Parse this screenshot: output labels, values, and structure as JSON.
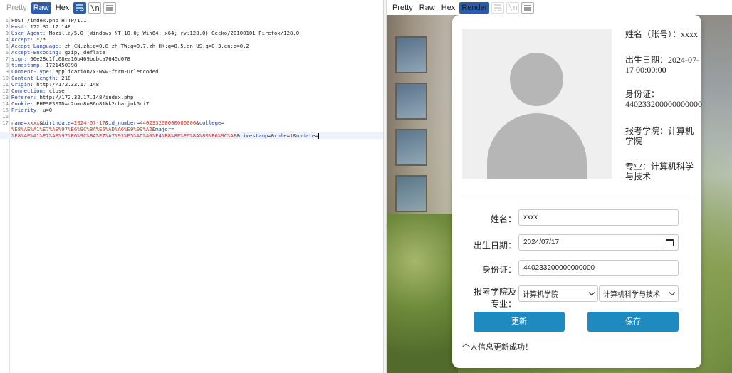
{
  "request_toolbar": {
    "pretty": "Pretty",
    "raw": "Raw",
    "hex": "Hex",
    "newline_toggle": "\\n"
  },
  "request": {
    "lines": [
      {
        "n": "1",
        "name": "",
        "rest": "POST /index.php HTTP/1.1"
      },
      {
        "n": "2",
        "name": "Host:",
        "rest": " 172.32.17.148"
      },
      {
        "n": "3",
        "name": "User-Agent:",
        "rest": " Mozilla/5.0 (Windows NT 10.0; Win64; x64; rv:128.0) Gecko/20100101 Firefox/128.0"
      },
      {
        "n": "4",
        "name": "Accept:",
        "rest": " */*"
      },
      {
        "n": "5",
        "name": "Accept-Language:",
        "rest": " zh-CN,zh;q=0.8,zh-TW;q=0.7,zh-HK;q=0.5,en-US;q=0.3,en;q=0.2"
      },
      {
        "n": "6",
        "name": "Accept-Encoding:",
        "rest": " gzip, deflate"
      },
      {
        "n": "7",
        "name": "sign:",
        "rest": " 66e28c1fc68ea10b469bcbca7645d078"
      },
      {
        "n": "8",
        "name": "timestamp:",
        "rest": " 1721450398"
      },
      {
        "n": "9",
        "name": "Content-Type:",
        "rest": " application/x-www-form-urlencoded"
      },
      {
        "n": "10",
        "name": "Content-Length:",
        "rest": " 218"
      },
      {
        "n": "11",
        "name": "Origin:",
        "rest": " http://172.32.17.148"
      },
      {
        "n": "12",
        "name": "Connection:",
        "rest": " close"
      },
      {
        "n": "13",
        "name": "Referer:",
        "rest": " http://172.32.17.148/index.php"
      },
      {
        "n": "14",
        "name": "Cookie:",
        "rest": " PHPSESSID=q2umn8n86u81kk2cbarjnk5ui7"
      },
      {
        "n": "15",
        "name": "Priority:",
        "rest": " u=0"
      },
      {
        "n": "16",
        "name": "",
        "rest": ""
      },
      {
        "n": "17",
        "name": "",
        "rest": ""
      }
    ],
    "body": {
      "l1a_key": "name",
      "l1a_val": "xxxx",
      "l1b_key": "birthdate",
      "l1b_val": "2024-07-17",
      "l1c_key": "id_number",
      "l1c_val": "440233200000000000",
      "l1d_key": "college",
      "l2_val": "%E8%AE%A1%E7%AE%97%E6%9C%BA%E5%AD%A6%E9%99%A2",
      "l2_key": "major",
      "l3_val": "%E8%AE%A1%E7%AE%97%E6%9C%BA%E7%A7%91%E5%AD%A6%E4%B8%8E%E6%8A%80%E6%9C%AF",
      "l3_k1": "timestamp",
      "l3_k2": "role",
      "l3_v2": "1",
      "l3_k3": "update"
    }
  },
  "response_toolbar": {
    "pretty": "Pretty",
    "raw": "Raw",
    "hex": "Hex",
    "render": "Render"
  },
  "profile": {
    "name_line": "姓名（账号）：xxxx",
    "birth_line": "出生日期：2024-07-17 00:00:00",
    "id_line": "身份证：440233200000000000",
    "college_line": "报考学院：计算机学院",
    "major_line": "专业：计算机科学与技术"
  },
  "form": {
    "name_label": "姓名：",
    "name_value": "xxxx",
    "birth_label": "出生日期：",
    "birth_value": "2024/07/17",
    "id_label": "身份证：",
    "id_value": "440233200000000000",
    "college_label_1": "报考学院及",
    "college_label_2": "专业：",
    "college_select": "计算机学院",
    "major_select": "计算机科学与技术",
    "update_button": "更新",
    "save_button": "保存",
    "status_message": "个人信息更新成功！"
  },
  "colors": {
    "accent": "#2a5ca8",
    "button": "#1f8ac0",
    "header_name": "#1f3f9a",
    "value_red": "#c2362a"
  }
}
